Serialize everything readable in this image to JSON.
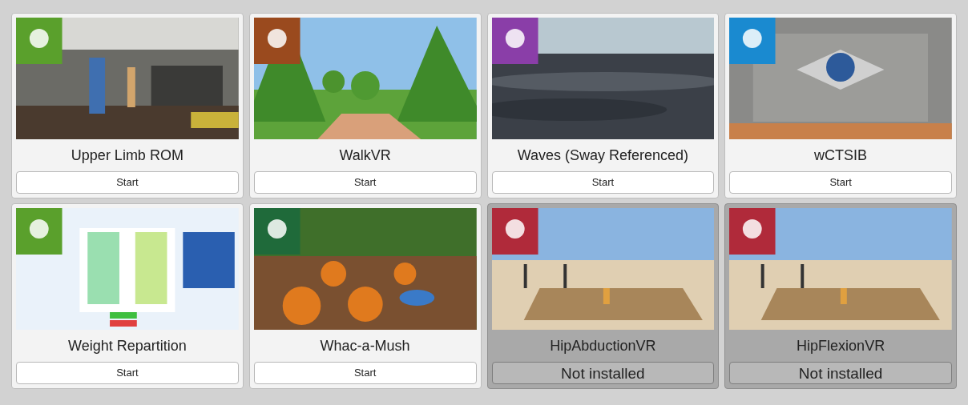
{
  "cards": [
    {
      "title": "Upper Limb ROM",
      "button": "Start",
      "installed": true
    },
    {
      "title": "WalkVR",
      "button": "Start",
      "installed": true
    },
    {
      "title": "Waves (Sway Referenced)",
      "button": "Start",
      "installed": true
    },
    {
      "title": "wCTSIB",
      "button": "Start",
      "installed": true
    },
    {
      "title": "Weight Repartition",
      "button": "Start",
      "installed": true
    },
    {
      "title": "Whac-a-Mush",
      "button": "Start",
      "installed": true
    },
    {
      "title": "HipAbductionVR",
      "button": "Not installed",
      "installed": false
    },
    {
      "title": "HipFlexionVR",
      "button": "Not installed",
      "installed": false
    }
  ]
}
